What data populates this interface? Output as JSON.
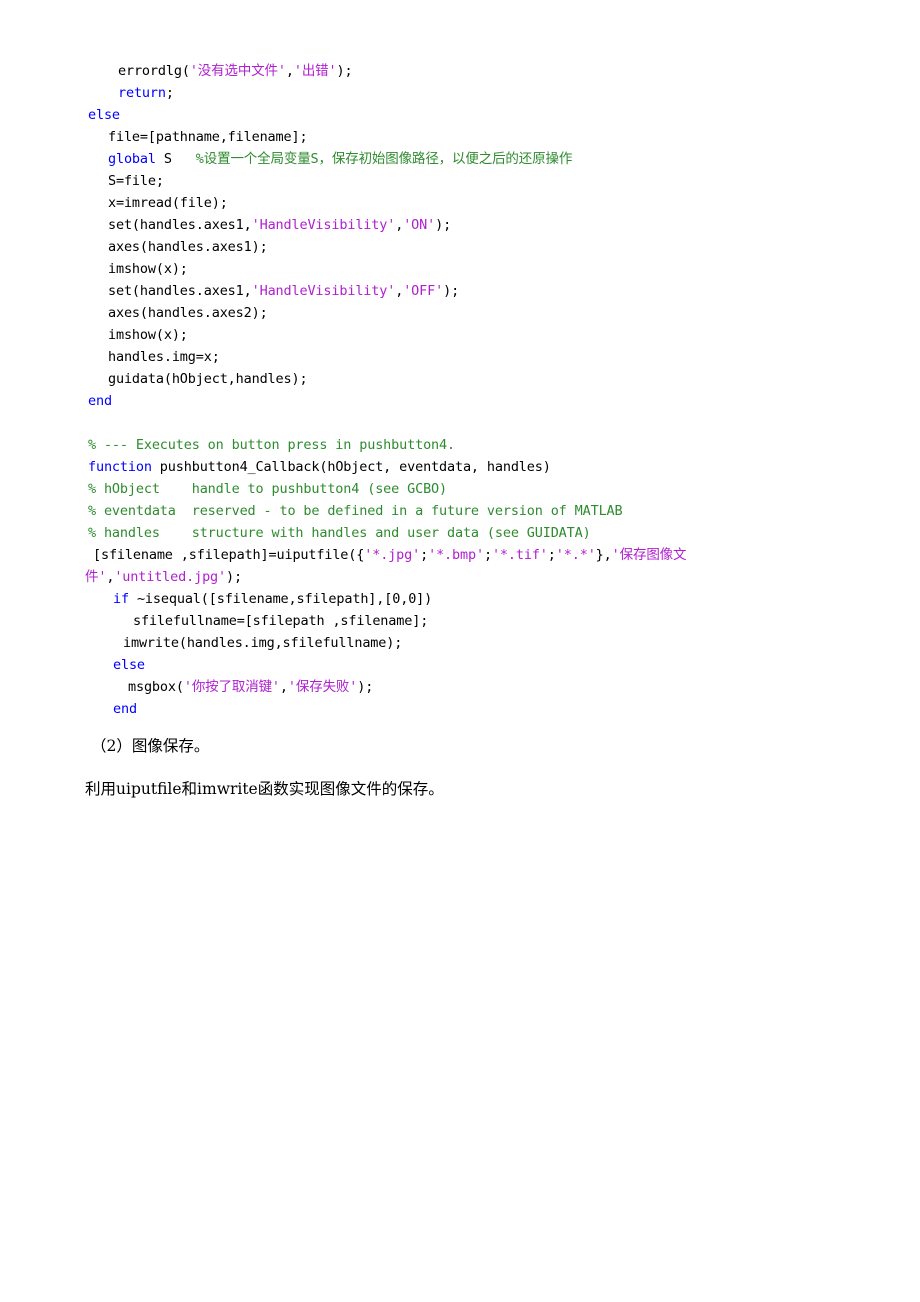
{
  "document": {
    "type": "code-listing-document",
    "language": "MATLAB",
    "background_color": "#ffffff",
    "syntax_colors": {
      "keyword": "#0000ff",
      "string": "#b020d0",
      "comment": "#2e8b2e",
      "plain": "#000000"
    }
  },
  "code_block": {
    "lines": [
      {
        "indent": 33,
        "tokens": [
          {
            "t": "plain",
            "v": "errordlg("
          },
          {
            "t": "string",
            "v": "'没有选中文件'"
          },
          {
            "t": "plain",
            "v": ","
          },
          {
            "t": "string",
            "v": "'出错'"
          },
          {
            "t": "plain",
            "v": ");"
          }
        ]
      },
      {
        "indent": 33,
        "tokens": [
          {
            "t": "keyword",
            "v": "return"
          },
          {
            "t": "plain",
            "v": ";"
          }
        ]
      },
      {
        "indent": 3,
        "tokens": [
          {
            "t": "keyword",
            "v": "else"
          }
        ]
      },
      {
        "indent": 23,
        "tokens": [
          {
            "t": "plain",
            "v": "file=[pathname,filename];"
          }
        ]
      },
      {
        "indent": 23,
        "tokens": [
          {
            "t": "keyword",
            "v": "global"
          },
          {
            "t": "plain",
            "v": " S   "
          },
          {
            "t": "comment",
            "v": "%设置一个全局变量S，保存初始图像路径，以便之后的还原操作"
          }
        ]
      },
      {
        "indent": 23,
        "tokens": [
          {
            "t": "plain",
            "v": "S=file;"
          }
        ]
      },
      {
        "indent": 23,
        "tokens": [
          {
            "t": "plain",
            "v": "x=imread(file);"
          }
        ]
      },
      {
        "indent": 23,
        "tokens": [
          {
            "t": "plain",
            "v": "set(handles.axes1,"
          },
          {
            "t": "string",
            "v": "'HandleVisibility'"
          },
          {
            "t": "plain",
            "v": ","
          },
          {
            "t": "string",
            "v": "'ON'"
          },
          {
            "t": "plain",
            "v": ");"
          }
        ]
      },
      {
        "indent": 23,
        "tokens": [
          {
            "t": "plain",
            "v": "axes(handles.axes1);"
          }
        ]
      },
      {
        "indent": 23,
        "tokens": [
          {
            "t": "plain",
            "v": "imshow(x);"
          }
        ]
      },
      {
        "indent": 23,
        "tokens": [
          {
            "t": "plain",
            "v": "set(handles.axes1,"
          },
          {
            "t": "string",
            "v": "'HandleVisibility'"
          },
          {
            "t": "plain",
            "v": ","
          },
          {
            "t": "string",
            "v": "'OFF'"
          },
          {
            "t": "plain",
            "v": ");"
          }
        ]
      },
      {
        "indent": 23,
        "tokens": [
          {
            "t": "plain",
            "v": "axes(handles.axes2);"
          }
        ]
      },
      {
        "indent": 23,
        "tokens": [
          {
            "t": "plain",
            "v": "imshow(x);"
          }
        ]
      },
      {
        "indent": 23,
        "tokens": [
          {
            "t": "plain",
            "v": "handles.img=x;"
          }
        ]
      },
      {
        "indent": 23,
        "tokens": [
          {
            "t": "plain",
            "v": "guidata(hObject,handles);"
          }
        ]
      },
      {
        "indent": 3,
        "tokens": [
          {
            "t": "keyword",
            "v": "end"
          }
        ]
      },
      {
        "indent": 0,
        "tokens": []
      },
      {
        "indent": 3,
        "tokens": [
          {
            "t": "comment",
            "v": "% --- Executes on button press in pushbutton4."
          }
        ]
      },
      {
        "indent": 3,
        "tokens": [
          {
            "t": "keyword",
            "v": "function"
          },
          {
            "t": "plain",
            "v": " pushbutton4_Callback(hObject, eventdata, handles)"
          }
        ]
      },
      {
        "indent": 3,
        "tokens": [
          {
            "t": "comment",
            "v": "% hObject    handle to pushbutton4 (see GCBO)"
          }
        ]
      },
      {
        "indent": 3,
        "tokens": [
          {
            "t": "comment",
            "v": "% eventdata  reserved - to be defined in a future version of MATLAB"
          }
        ]
      },
      {
        "indent": 3,
        "tokens": [
          {
            "t": "comment",
            "v": "% handles    structure with handles and user data (see GUIDATA)"
          }
        ]
      },
      {
        "indent": 8,
        "tokens": [
          {
            "t": "plain",
            "v": "[sfilename ,sfilepath]=uiputfile({"
          },
          {
            "t": "string",
            "v": "'*.jpg'"
          },
          {
            "t": "plain",
            "v": ";"
          },
          {
            "t": "string",
            "v": "'*.bmp'"
          },
          {
            "t": "plain",
            "v": ";"
          },
          {
            "t": "string",
            "v": "'*.tif'"
          },
          {
            "t": "plain",
            "v": ";"
          },
          {
            "t": "string",
            "v": "'*.*'"
          },
          {
            "t": "plain",
            "v": "},"
          },
          {
            "t": "string",
            "v": "'保存图像文"
          }
        ]
      },
      {
        "indent": 0,
        "tokens": [
          {
            "t": "string",
            "v": "件'"
          },
          {
            "t": "plain",
            "v": ","
          },
          {
            "t": "string",
            "v": "'untitled.jpg'"
          },
          {
            "t": "plain",
            "v": ");"
          }
        ]
      },
      {
        "indent": 28,
        "tokens": [
          {
            "t": "keyword",
            "v": "if"
          },
          {
            "t": "plain",
            "v": " ~isequal([sfilename,sfilepath],[0,0])"
          }
        ]
      },
      {
        "indent": 48,
        "tokens": [
          {
            "t": "plain",
            "v": "sfilefullname=[sfilepath ,sfilename];"
          }
        ]
      },
      {
        "indent": 38,
        "tokens": [
          {
            "t": "plain",
            "v": "imwrite(handles.img,sfilefullname);"
          }
        ]
      },
      {
        "indent": 28,
        "tokens": [
          {
            "t": "keyword",
            "v": "else"
          }
        ]
      },
      {
        "indent": 43,
        "tokens": [
          {
            "t": "plain",
            "v": "msgbox("
          },
          {
            "t": "string",
            "v": "'你按了取消键'"
          },
          {
            "t": "plain",
            "v": ","
          },
          {
            "t": "string",
            "v": "'保存失败'"
          },
          {
            "t": "plain",
            "v": ");"
          }
        ]
      },
      {
        "indent": 28,
        "tokens": [
          {
            "t": "keyword",
            "v": "end"
          }
        ]
      }
    ]
  },
  "paragraphs": [
    {
      "id": "item-2-heading",
      "text": "（2）图像保存。"
    },
    {
      "id": "item-2-body",
      "text": "利用uiputfile和imwrite函数实现图像文件的保存。"
    }
  ]
}
